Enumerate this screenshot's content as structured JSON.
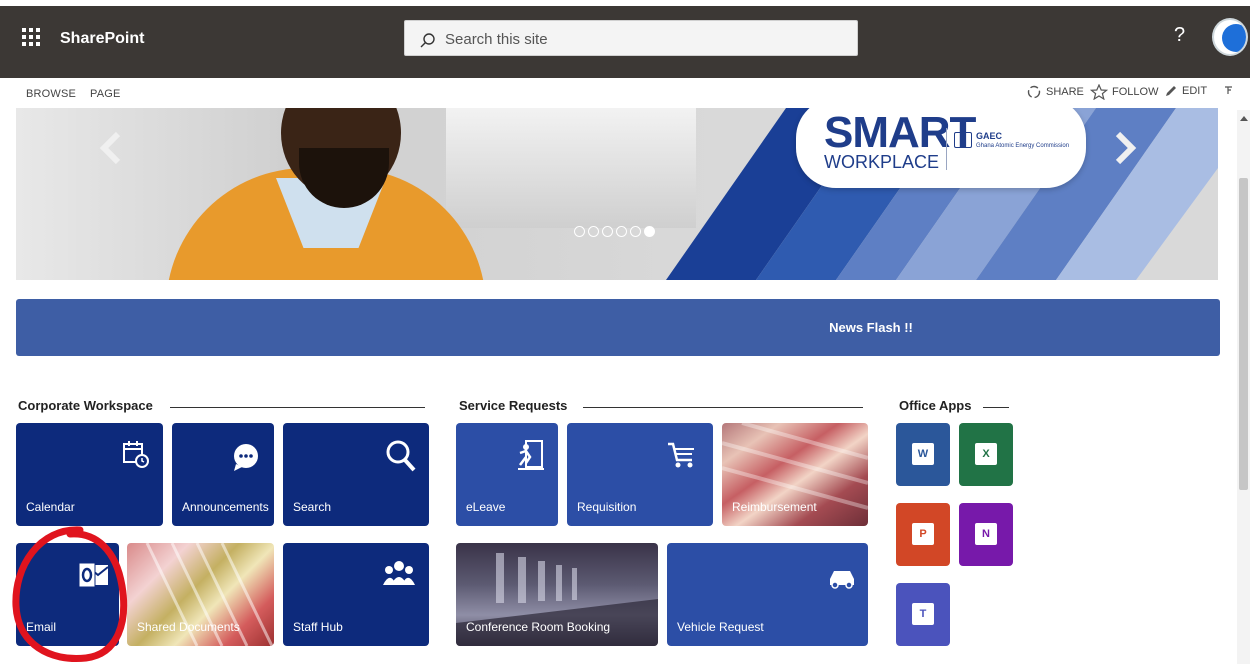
{
  "suitebar": {
    "app_name": "SharePoint",
    "search_placeholder": "Search this site",
    "help_glyph": "?",
    "icons": [
      "app-launcher-icon",
      "search-icon",
      "help-icon",
      "avatar"
    ]
  },
  "ribbon": {
    "tabs": [
      "BROWSE",
      "PAGE"
    ],
    "actions": [
      {
        "label": "SHARE",
        "icon": "share-icon"
      },
      {
        "label": "FOLLOW",
        "icon": "star-icon"
      },
      {
        "label": "EDIT",
        "icon": "pencil-icon"
      }
    ],
    "focus_icon": "focus-mode-icon"
  },
  "banner": {
    "logo_title": "SMART",
    "logo_subtitle": "WORKPLACE",
    "org_short": "GAEC",
    "org_full": "Ghana Atomic Energy Commission",
    "slide_count": 6,
    "active_slide": 6,
    "colors": {
      "brand_blue": "#1f3d8a",
      "stripe_blue": "#1a3f96"
    }
  },
  "news": {
    "label": "News Flash !!"
  },
  "sections": {
    "corporate": {
      "title": "Corporate Workspace",
      "tiles": [
        {
          "label": "Calendar",
          "icon": "calendar-icon"
        },
        {
          "label": "Announcements",
          "icon": "chat-bubble-icon"
        },
        {
          "label": "Search",
          "icon": "search-icon"
        },
        {
          "label": "Email",
          "icon": "outlook-icon"
        },
        {
          "label": "Shared Documents",
          "icon": "folders-photo"
        },
        {
          "label": "Staff Hub",
          "icon": "people-icon"
        }
      ]
    },
    "service": {
      "title": "Service Requests",
      "tiles": [
        {
          "label": "eLeave",
          "icon": "exit-running-icon"
        },
        {
          "label": "Requisition",
          "icon": "cart-icon"
        },
        {
          "label": "Reimbursement",
          "icon": "banknotes-photo"
        },
        {
          "label": "Conference Room Booking",
          "icon": "conference-room-photo"
        },
        {
          "label": "Vehicle Request",
          "icon": "car-icon"
        }
      ]
    },
    "office": {
      "title": "Office Apps",
      "apps": [
        {
          "name": "Word",
          "letter": "W",
          "color": "#2b579a"
        },
        {
          "name": "Excel",
          "letter": "X",
          "color": "#217346"
        },
        {
          "name": "PowerPoint",
          "letter": "P",
          "color": "#d24726"
        },
        {
          "name": "OneNote",
          "letter": "N",
          "color": "#7719aa"
        },
        {
          "name": "Teams",
          "letter": "T",
          "color": "#4b53bc"
        }
      ]
    }
  },
  "annotation": {
    "color": "#e0141e",
    "target": "Email"
  }
}
